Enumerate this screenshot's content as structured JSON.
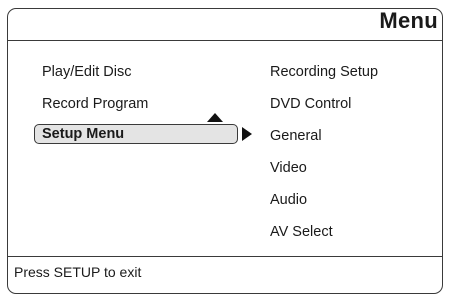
{
  "header": {
    "title": "Menu"
  },
  "left_menu": {
    "items": [
      {
        "label": "Play/Edit Disc"
      },
      {
        "label": "Record Program"
      },
      {
        "label": "Setup Menu"
      }
    ],
    "selected_index": 2
  },
  "right_menu": {
    "items": [
      {
        "label": "Recording Setup"
      },
      {
        "label": "DVD Control"
      },
      {
        "label": "General"
      },
      {
        "label": "Video"
      },
      {
        "label": "Audio"
      },
      {
        "label": "AV Select"
      }
    ]
  },
  "footer": {
    "hint": "Press SETUP to exit"
  },
  "colors": {
    "frame": "#3a3a3a",
    "highlight": "#e4e4e4",
    "text": "#1a1a1a"
  },
  "icons": {
    "scroll_up": "up-triangle-icon",
    "submenu": "right-triangle-icon"
  }
}
